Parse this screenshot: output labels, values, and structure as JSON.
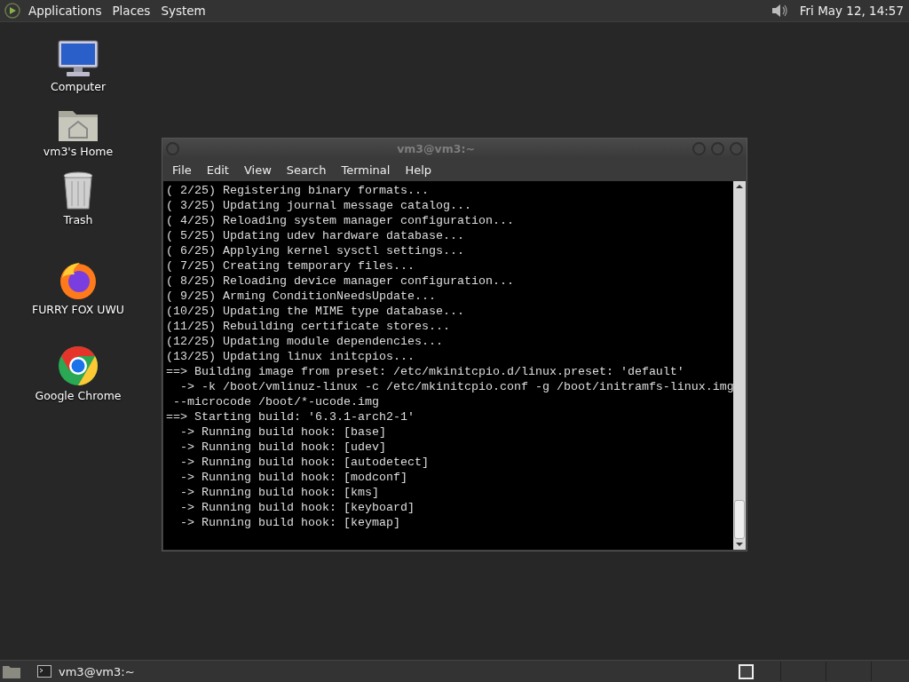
{
  "top_panel": {
    "menus": [
      "Applications",
      "Places",
      "System"
    ],
    "clock": "Fri May 12, 14:57"
  },
  "desktop_icons": [
    {
      "kind": "computer",
      "label": "Computer"
    },
    {
      "kind": "home",
      "label": "vm3's Home"
    },
    {
      "kind": "trash",
      "label": "Trash"
    },
    {
      "kind": "firefox",
      "label": "FURRY FOX UWU"
    },
    {
      "kind": "chrome",
      "label": "Google Chrome"
    }
  ],
  "terminal": {
    "title": "vm3@vm3:~",
    "menus": [
      "File",
      "Edit",
      "View",
      "Search",
      "Terminal",
      "Help"
    ],
    "lines": [
      "( 2/25) Registering binary formats...",
      "( 3/25) Updating journal message catalog...",
      "( 4/25) Reloading system manager configuration...",
      "( 5/25) Updating udev hardware database...",
      "( 6/25) Applying kernel sysctl settings...",
      "( 7/25) Creating temporary files...",
      "( 8/25) Reloading device manager configuration...",
      "( 9/25) Arming ConditionNeedsUpdate...",
      "(10/25) Updating the MIME type database...",
      "(11/25) Rebuilding certificate stores...",
      "(12/25) Updating module dependencies...",
      "(13/25) Updating linux initcpios...",
      "==> Building image from preset: /etc/mkinitcpio.d/linux.preset: 'default'",
      "  -> -k /boot/vmlinuz-linux -c /etc/mkinitcpio.conf -g /boot/initramfs-linux.img",
      " --microcode /boot/*-ucode.img",
      "==> Starting build: '6.3.1-arch2-1'",
      "  -> Running build hook: [base]",
      "  -> Running build hook: [udev]",
      "  -> Running build hook: [autodetect]",
      "  -> Running build hook: [modconf]",
      "  -> Running build hook: [kms]",
      "  -> Running build hook: [keyboard]",
      "  -> Running build hook: [keymap]"
    ]
  },
  "bottom_panel": {
    "tasks": [
      {
        "label": "vm3@vm3:~",
        "selected": false
      }
    ]
  }
}
